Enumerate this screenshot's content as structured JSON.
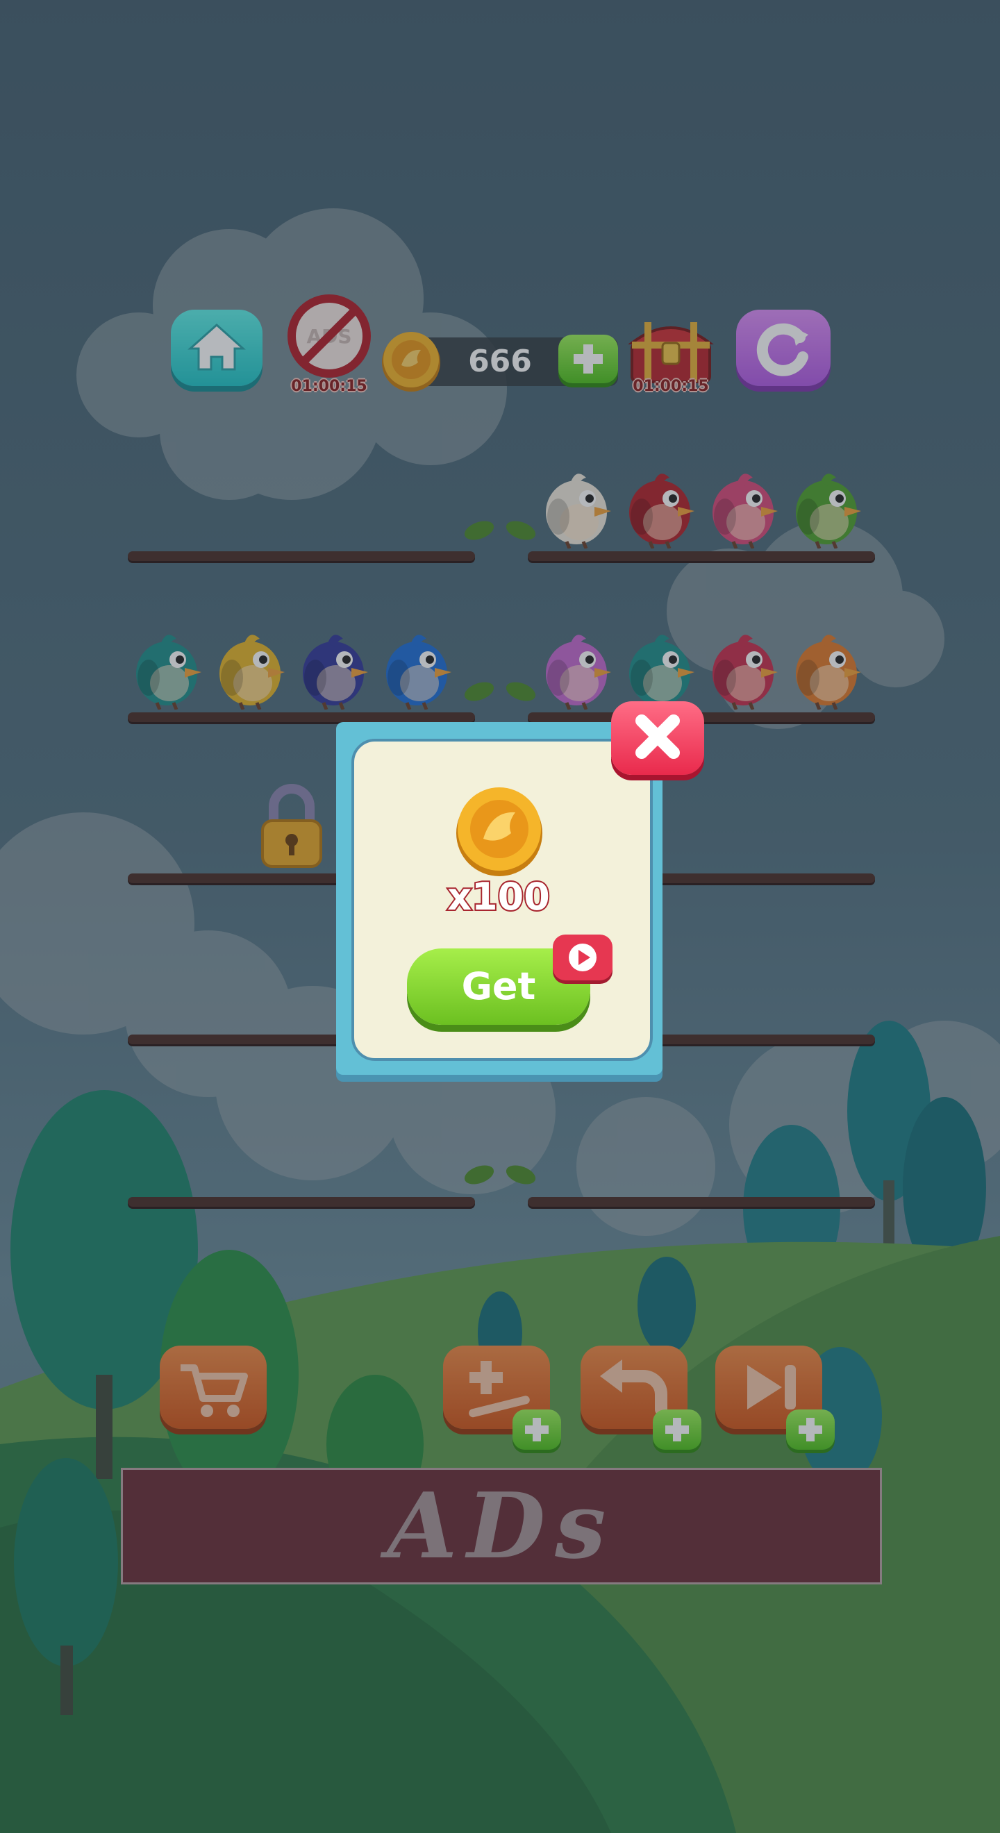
{
  "hud": {
    "coins": "666",
    "no_ads_timer": "01:00:15",
    "chest_timer": "01:00:15"
  },
  "icons": {
    "home": "home-icon",
    "no_ads": "no-ads-icon",
    "coin": "coin-icon",
    "add_coins": "plus-icon",
    "chest": "treasure-chest-icon",
    "restart": "restart-icon",
    "lock": "padlock-icon",
    "shop": "cart-icon",
    "add_branch": "add-branch-icon",
    "undo": "undo-icon",
    "skip": "skip-icon",
    "close": "close-icon",
    "video": "video-play-icon"
  },
  "birds": {
    "row1_right": [
      "white",
      "red",
      "pink",
      "green"
    ],
    "row2_left": [
      "teal",
      "yellow",
      "navy",
      "blue"
    ],
    "row2_right": [
      "purple",
      "teal",
      "crimson",
      "orange"
    ]
  },
  "colors": {
    "white": "#efe9dc",
    "red": "#b3222a",
    "pink": "#d94a7a",
    "green": "#4fa22d",
    "teal": "#1f8f8a",
    "yellow": "#e5b52a",
    "navy": "#333a9a",
    "blue": "#1f6fd8",
    "purple": "#c56ad0",
    "crimson": "#c82e4e",
    "orange": "#e07a2a",
    "modal_border": "#63c0d6",
    "modal_bg": "#f3f1da",
    "get_green": "#7fcf2c",
    "close_red": "#ee3f5c",
    "ads_bg": "#6b2e38"
  },
  "reward_popup": {
    "amount": "x100",
    "get_label": "Get"
  },
  "ads_banner": {
    "text": "ADs"
  }
}
